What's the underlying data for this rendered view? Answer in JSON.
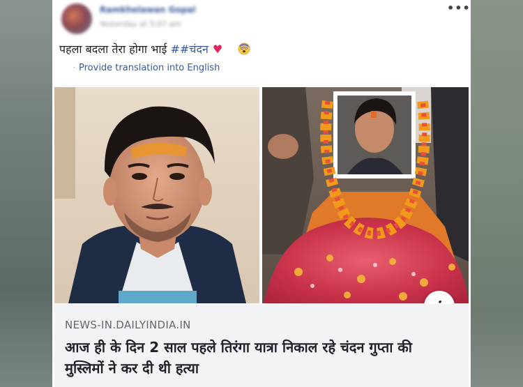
{
  "post": {
    "author_name": "Ramkhelawan Gopal",
    "timestamp": "Yesterday at 5:07 am",
    "text_main": "पहला बदला तेरा होगा भाई ",
    "hashtag": "##चंदन",
    "heart": "♥",
    "translate_link": "Provide translation into English",
    "more_options": "•••",
    "info_icon": "i"
  },
  "link_preview": {
    "domain": "NEWS-IN.DAILYINDIA.IN",
    "title": "आज ही के दिन 2 साल पहले तिरंगा यात्रा निकाल रहे चंदन गुप्ता की मुस्लिमों ने कर दी थी हत्या"
  },
  "icons": {
    "more": "more-options-icon",
    "heart": "heart-icon",
    "emoji": "face-emoji-icon",
    "info": "info-icon"
  },
  "colors": {
    "link_blue": "#385898",
    "heart_red": "#e0245e",
    "link_box_bg": "#f2f3f5"
  }
}
